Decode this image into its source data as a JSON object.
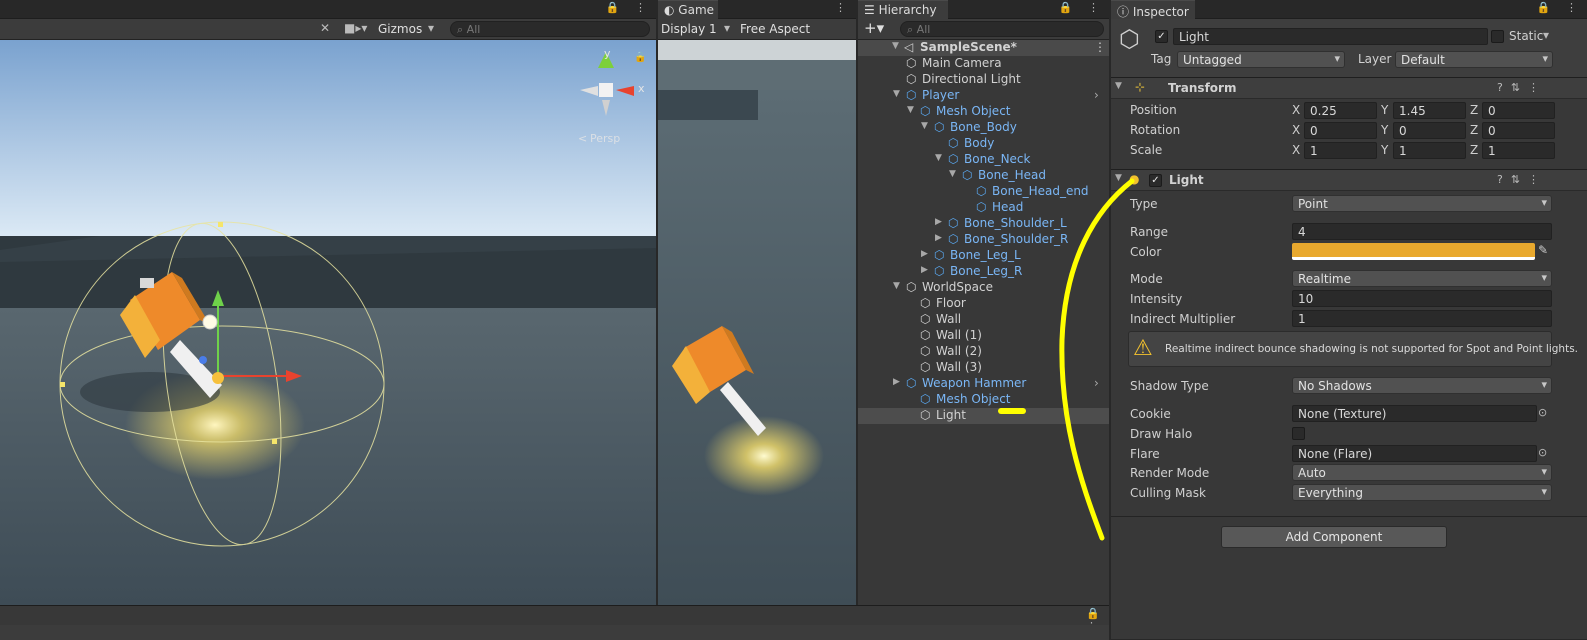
{
  "scene": {
    "toolbar": {
      "gizmos_label": "Gizmos",
      "search_placeholder": "All"
    },
    "gizmo": {
      "y_label": "y",
      "x_label": "x",
      "persp_label": "Persp"
    }
  },
  "game": {
    "tab_label": "Game",
    "display_label": "Display 1",
    "aspect_label": "Free Aspect"
  },
  "hierarchy": {
    "tab_label": "Hierarchy",
    "search_placeholder": "All",
    "scene_name": "SampleScene*",
    "items": [
      {
        "label": "Main Camera",
        "prefab": false
      },
      {
        "label": "Directional Light",
        "prefab": false
      },
      {
        "label": "Player",
        "prefab": true
      },
      {
        "label": "Mesh Object",
        "prefab": true
      },
      {
        "label": "Bone_Body",
        "prefab": true
      },
      {
        "label": "Body",
        "prefab": true
      },
      {
        "label": "Bone_Neck",
        "prefab": true
      },
      {
        "label": "Bone_Head",
        "prefab": true
      },
      {
        "label": "Bone_Head_end",
        "prefab": true
      },
      {
        "label": "Head",
        "prefab": true
      },
      {
        "label": "Bone_Shoulder_L",
        "prefab": true
      },
      {
        "label": "Bone_Shoulder_R",
        "prefab": true
      },
      {
        "label": "Bone_Leg_L",
        "prefab": true
      },
      {
        "label": "Bone_Leg_R",
        "prefab": true
      },
      {
        "label": "WorldSpace",
        "prefab": false
      },
      {
        "label": "Floor",
        "prefab": false
      },
      {
        "label": "Wall",
        "prefab": false
      },
      {
        "label": "Wall (1)",
        "prefab": false
      },
      {
        "label": "Wall (2)",
        "prefab": false
      },
      {
        "label": "Wall (3)",
        "prefab": false
      },
      {
        "label": "Weapon Hammer",
        "prefab": true
      },
      {
        "label": "Mesh Object",
        "prefab": true
      },
      {
        "label": "Light",
        "prefab": false
      }
    ]
  },
  "inspector": {
    "tab_label": "Inspector",
    "object_name": "Light",
    "static_label": "Static",
    "tag_label": "Tag",
    "tag_value": "Untagged",
    "layer_label": "Layer",
    "layer_value": "Default",
    "transform": {
      "title": "Transform",
      "position_label": "Position",
      "rotation_label": "Rotation",
      "scale_label": "Scale",
      "position": {
        "x": "0.25",
        "y": "1.45",
        "z": "0"
      },
      "rotation": {
        "x": "0",
        "y": "0",
        "z": "0"
      },
      "scale": {
        "x": "1",
        "y": "1",
        "z": "1"
      },
      "x": "X",
      "y": "Y",
      "z": "Z"
    },
    "light": {
      "title": "Light",
      "type_label": "Type",
      "type_value": "Point",
      "range_label": "Range",
      "range_value": "4",
      "color_label": "Color",
      "color_value": "#e9a92e",
      "mode_label": "Mode",
      "mode_value": "Realtime",
      "intensity_label": "Intensity",
      "intensity_value": "10",
      "indirect_label": "Indirect Multiplier",
      "indirect_value": "1",
      "warning": "Realtime indirect bounce shadowing is not supported for Spot and Point lights.",
      "shadow_label": "Shadow Type",
      "shadow_value": "No Shadows",
      "cookie_label": "Cookie",
      "cookie_value": "None (Texture)",
      "halo_label": "Draw Halo",
      "flare_label": "Flare",
      "flare_value": "None (Flare)",
      "render_label": "Render Mode",
      "render_value": "Auto",
      "culling_label": "Culling Mask",
      "culling_value": "Everything"
    },
    "add_component_label": "Add Component"
  },
  "colors": {
    "accent_blue": "#7ab6f5",
    "annotation_yellow": "#ffff00",
    "light_color": "#e9a92e"
  }
}
